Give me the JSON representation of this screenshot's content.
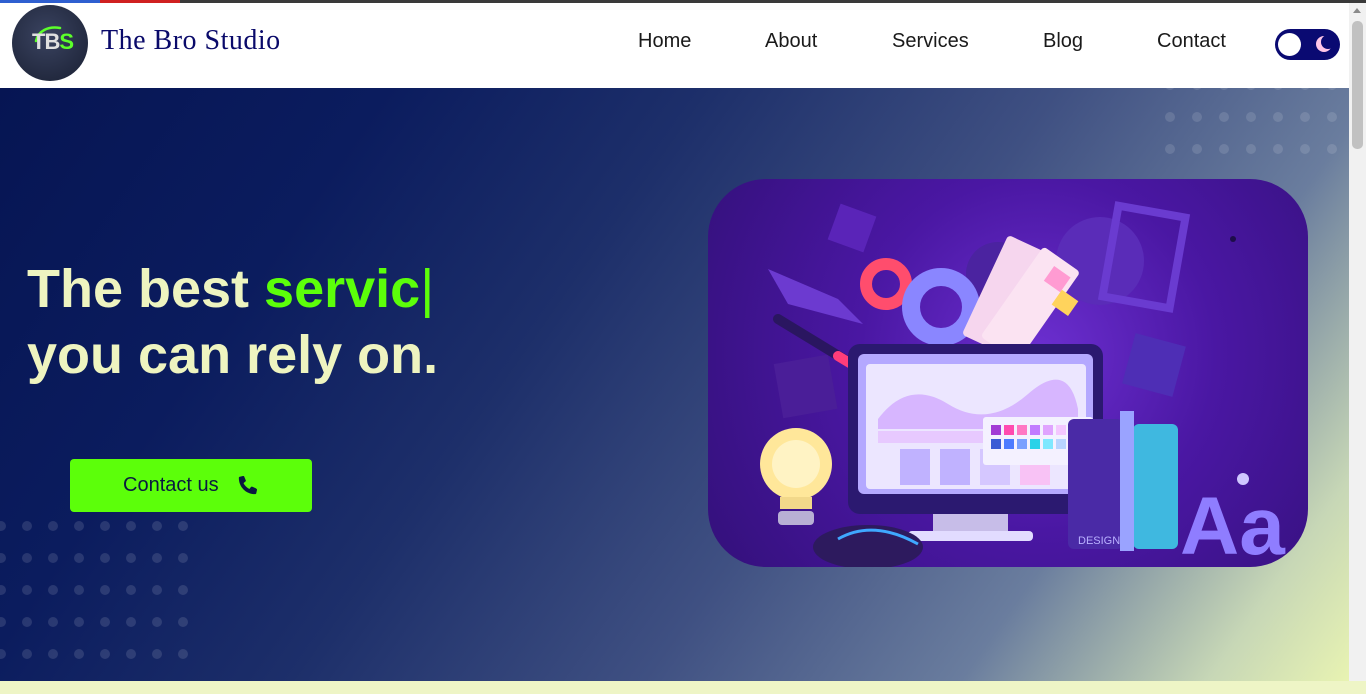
{
  "brand": {
    "logo_text_main": "TB",
    "logo_text_accent": "S",
    "name": "The Bro Studio"
  },
  "nav": {
    "links": [
      {
        "label": "Home"
      },
      {
        "label": "About"
      },
      {
        "label": "Services"
      },
      {
        "label": "Blog"
      },
      {
        "label": "Contact"
      }
    ],
    "theme_toggle": {
      "icon_off": "sun-knob-icon",
      "icon_on": "moon-icon",
      "state": "light"
    }
  },
  "hero": {
    "headline_line1_start": "The best ",
    "headline_line1_accent": "servic",
    "headline_cursor": "|",
    "headline_line2": "you can rely on.",
    "cta_label": "Contact us",
    "cta_icon": "phone-icon",
    "illustration": "web-design-illustration",
    "illustration_text": "Aa",
    "illustration_book_label": "DESIGN"
  },
  "colors": {
    "accent": "#5cff0a",
    "brand_navy": "#0a0a72",
    "headline": "#eef4c0",
    "hero_start": "#061553",
    "hero_end": "#e8f3b2"
  }
}
